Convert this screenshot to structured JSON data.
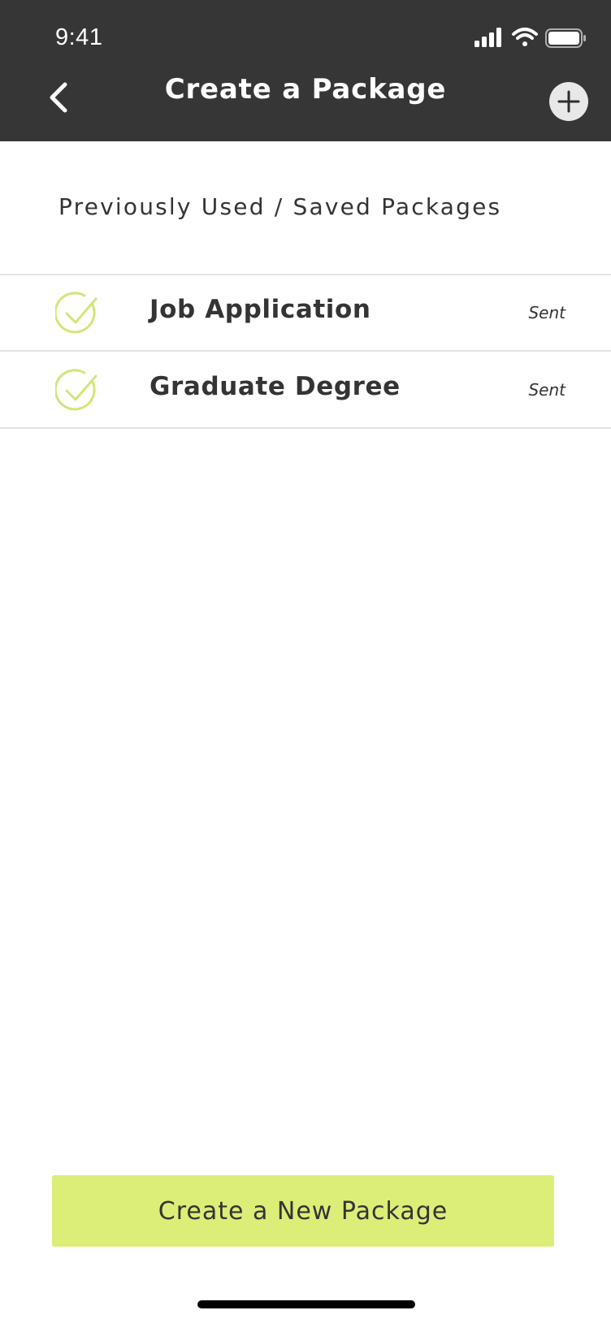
{
  "status_bar": {
    "time": "9:41",
    "icons": [
      "signal-icon",
      "wifi-icon",
      "battery-icon"
    ]
  },
  "nav": {
    "title": "Create a Package",
    "back_icon": "chevron-left-icon",
    "add_icon": "plus-icon"
  },
  "section": {
    "heading": "Previously Used / Saved Packages"
  },
  "packages": [
    {
      "icon": "check-circle-icon",
      "title": "Job Application",
      "status": "Sent"
    },
    {
      "icon": "check-circle-icon",
      "title": "Graduate Degree",
      "status": "Sent"
    }
  ],
  "footer": {
    "create_button_label": "Create a New Package"
  },
  "colors": {
    "header_bg": "#363636",
    "accent": "#dcee78",
    "check_icon": "#d3e57a",
    "text": "#343434",
    "divider": "#e2e2e2"
  }
}
